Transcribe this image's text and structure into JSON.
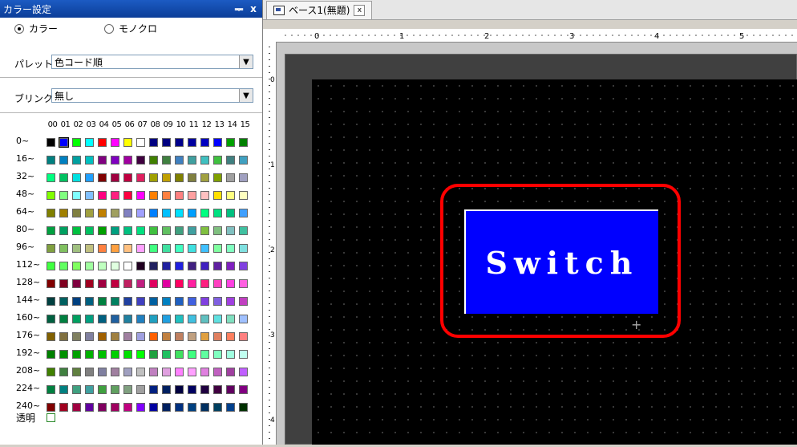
{
  "panel": {
    "title": "カラー設定",
    "pin_glyph": "ᆓ",
    "close_glyph": "x",
    "mode_color_label": "カラー",
    "mode_mono_label": "モノクロ",
    "palette_label": "パレット",
    "palette_value": "色コード順",
    "blink_label": "ブリンク",
    "blink_value": "無し",
    "transparent_label": "透明"
  },
  "grid": {
    "columns": [
      "00",
      "01",
      "02",
      "03",
      "04",
      "05",
      "06",
      "07",
      "08",
      "09",
      "10",
      "11",
      "12",
      "13",
      "14",
      "15"
    ],
    "row_labels": [
      "0~",
      "16~",
      "32~",
      "48~",
      "64~",
      "80~",
      "96~",
      "112~",
      "128~",
      "144~",
      "160~",
      "176~",
      "192~",
      "208~",
      "224~",
      "240~"
    ],
    "colors": [
      [
        "#000000",
        "#0000ff",
        "#00ff00",
        "#00ffff",
        "#ff0000",
        "#ff00ff",
        "#ffff00",
        "#ffffff",
        "#000080",
        "#000080",
        "#00008b",
        "#0000a0",
        "#0000c0",
        "#0000ff",
        "#00a000",
        "#008000"
      ],
      [
        "#008080",
        "#0080c0",
        "#00a0a0",
        "#00c0c0",
        "#800080",
        "#8000c0",
        "#a000a0",
        "#400040",
        "#408000",
        "#408040",
        "#4080c0",
        "#40a0a0",
        "#40c0c0",
        "#40c040",
        "#408080",
        "#40a0c0"
      ],
      [
        "#00ff80",
        "#00c060",
        "#00e0e0",
        "#20a0ff",
        "#800000",
        "#a00040",
        "#c00040",
        "#e02060",
        "#a0a000",
        "#c0a000",
        "#808000",
        "#808040",
        "#a0a040",
        "#80a000",
        "#a0a0a0",
        "#a0a0c0"
      ],
      [
        "#80ff00",
        "#80ff80",
        "#80ffff",
        "#80c0ff",
        "#ff0080",
        "#ff2080",
        "#ff0040",
        "#ff00ff",
        "#ff8000",
        "#ff8040",
        "#ff8080",
        "#ffa0a0",
        "#ffc0c0",
        "#ffe000",
        "#ffff80",
        "#ffffc0"
      ],
      [
        "#808000",
        "#a08000",
        "#808040",
        "#a0a040",
        "#c08000",
        "#a0a060",
        "#8080c0",
        "#a0a0ff",
        "#0080ff",
        "#00c0ff",
        "#00e0ff",
        "#00a0ff",
        "#00ff80",
        "#00e080",
        "#00c080",
        "#40a0ff"
      ],
      [
        "#00a040",
        "#00a060",
        "#00c040",
        "#00c060",
        "#00a000",
        "#00a080",
        "#00c080",
        "#00e080",
        "#40c040",
        "#60c060",
        "#40a080",
        "#40a0a0",
        "#80c040",
        "#80c080",
        "#80c0c0",
        "#40c0a0"
      ],
      [
        "#80a040",
        "#80c060",
        "#a0c080",
        "#c0c080",
        "#ff8040",
        "#ffa040",
        "#ffc080",
        "#ffa0ff",
        "#40ff80",
        "#40e0a0",
        "#40ffc0",
        "#40e0e0",
        "#40c0ff",
        "#80ffa0",
        "#80ffc0",
        "#80e0e0"
      ],
      [
        "#40ff40",
        "#60ff60",
        "#80ff60",
        "#a0ffa0",
        "#c0ffc0",
        "#e0ffe0",
        "#ffffff",
        "#200020",
        "#202060",
        "#2020a0",
        "#2020e0",
        "#402080",
        "#4020c0",
        "#6020a0",
        "#8020c0",
        "#8040e0"
      ],
      [
        "#800000",
        "#800020",
        "#800040",
        "#a00020",
        "#a00040",
        "#c00040",
        "#c02060",
        "#c02080",
        "#e00060",
        "#e000a0",
        "#ff0060",
        "#ff20a0",
        "#ff2080",
        "#ff40c0",
        "#ff40e0",
        "#ff60e0"
      ],
      [
        "#004040",
        "#006060",
        "#004080",
        "#006080",
        "#008040",
        "#008060",
        "#2040a0",
        "#4040c0",
        "#0060a0",
        "#0080c0",
        "#2060c0",
        "#4060e0",
        "#8040e0",
        "#8060e0",
        "#a040e0",
        "#c040c0"
      ],
      [
        "#006040",
        "#008040",
        "#00a060",
        "#00a080",
        "#006080",
        "#2060a0",
        "#2080a0",
        "#2080c0",
        "#20a0c0",
        "#20a0e0",
        "#20c0c0",
        "#40c0e0",
        "#60c0c0",
        "#60e0e0",
        "#80e0c0",
        "#a0c0ff"
      ],
      [
        "#806000",
        "#807040",
        "#808060",
        "#8080a0",
        "#a06000",
        "#a08040",
        "#a080a0",
        "#a0a0e0",
        "#ff6000",
        "#c08040",
        "#c08060",
        "#c0a080",
        "#e0a040",
        "#e08060",
        "#ff8060",
        "#ff8080"
      ],
      [
        "#008000",
        "#009000",
        "#00a000",
        "#00b000",
        "#00c000",
        "#00d000",
        "#00e000",
        "#00ff00",
        "#20a040",
        "#20c060",
        "#40e060",
        "#40ff80",
        "#60ffa0",
        "#80ffc0",
        "#a0ffe0",
        "#c0fff0"
      ],
      [
        "#408000",
        "#408040",
        "#608040",
        "#808080",
        "#8080a0",
        "#a080a0",
        "#a0a0c0",
        "#c0c0c0",
        "#c080c0",
        "#e0a0e0",
        "#ff80ff",
        "#ffa0ff",
        "#e080e0",
        "#c060c0",
        "#a040a0",
        "#c060ff"
      ],
      [
        "#008040",
        "#008080",
        "#40a080",
        "#40a0a0",
        "#40a040",
        "#60a060",
        "#80a080",
        "#a0a0a0",
        "#002080",
        "#002060",
        "#000040",
        "#000060",
        "#200040",
        "#400040",
        "#600060",
        "#800080"
      ],
      [
        "#800000",
        "#a00020",
        "#a00040",
        "#6000a0",
        "#800060",
        "#a00060",
        "#c00080",
        "#8000ff",
        "#0000a0",
        "#002060",
        "#003080",
        "#004080",
        "#003060",
        "#004060",
        "#00408c",
        "#003000"
      ]
    ]
  },
  "editor": {
    "tab_label": "ベース1(無題)",
    "tab_close_glyph": "x",
    "ruler_numbers": [
      "0",
      "1",
      "2",
      "3",
      "4",
      "5"
    ],
    "vruler_numbers": [
      "0",
      "1",
      "2",
      "3",
      "4"
    ],
    "switch_text": "Switch",
    "crosshair_glyph": "+"
  }
}
